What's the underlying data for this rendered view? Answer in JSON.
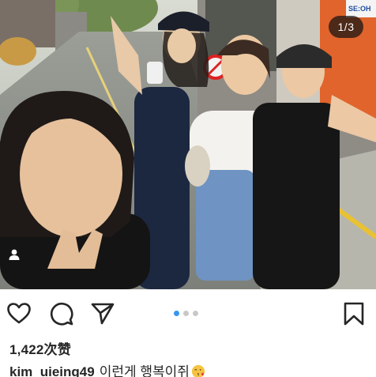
{
  "post": {
    "media": {
      "counter": "1/3",
      "current_slide": 1,
      "total_slides": 3,
      "storefront_sign": "SE:OH"
    },
    "actions": {
      "like_icon": "heart-icon",
      "comment_icon": "comment-bubble-icon",
      "share_icon": "paper-plane-icon",
      "save_icon": "bookmark-icon",
      "tag_icon": "user-tag-icon"
    },
    "likes": "1,422次赞",
    "caption": {
      "username": "kim_uieing49",
      "text": "이런게 행복이쥐",
      "emoji_icon": "face-blowing-kiss-emoji"
    }
  },
  "colors": {
    "carousel_active_dot": "#3897f0",
    "carousel_inactive_dot": "#c8c8c8",
    "text": "#262626"
  }
}
